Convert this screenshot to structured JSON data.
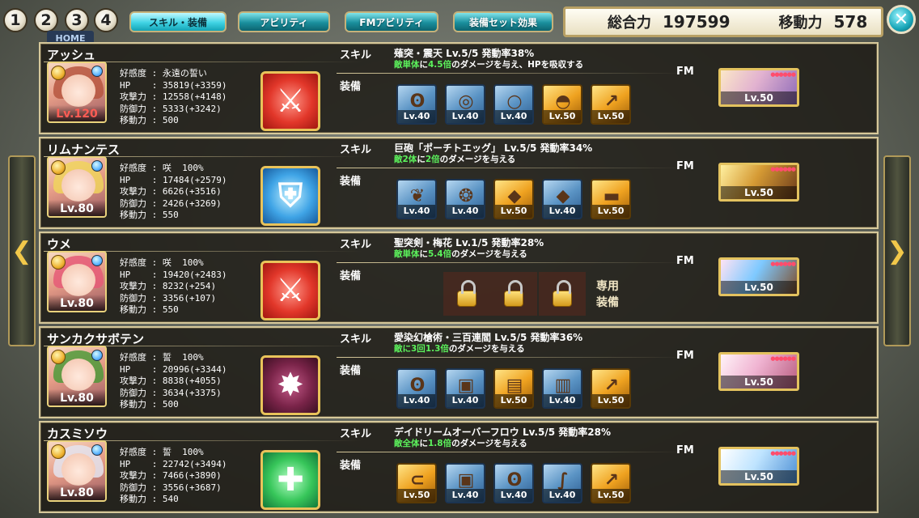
{
  "top": {
    "numbers": [
      "1",
      "2",
      "3",
      "4"
    ],
    "tabs": [
      "スキル・装備",
      "アビリティ",
      "FMアビリティ",
      "装備セット効果"
    ],
    "total_power_label": "総合力",
    "total_power_value": "197599",
    "movement_label": "移動力",
    "movement_value": "578",
    "close_icon": "close-icon",
    "home_label": "HOME"
  },
  "stat_labels": {
    "affinity": "好感度",
    "hp": "HP",
    "attack": "攻撃力",
    "defense": "防御力",
    "movement": "移動力"
  },
  "labels": {
    "skill": "スキル",
    "equip": "装備",
    "fm": "FM",
    "exclusive": "専用装備"
  },
  "characters": [
    {
      "name": "アッシュ",
      "level": "Lv.120",
      "affinity": "永遠の誓い",
      "hp": "35819(+3359)",
      "attack": "12558(+4148)",
      "defense": "5333(+3242)",
      "movement": "500",
      "skill_icon": "sword-icon",
      "skill_name": "薙突・震天 Lv.5/5 発動率38%",
      "skill_desc_a": "敵単体",
      "skill_desc_b": "に",
      "skill_desc_c": "4.5倍",
      "skill_desc_d": "のダメージを与え、HPを吸収する",
      "equips": [
        {
          "lv": "Lv.40",
          "tone": "blue",
          "icon": "necklace-icon"
        },
        {
          "lv": "Lv.40",
          "tone": "blue",
          "icon": "bracelet-icon"
        },
        {
          "lv": "Lv.40",
          "tone": "blue",
          "icon": "ring-icon"
        },
        {
          "lv": "Lv.50",
          "tone": "gold",
          "icon": "helmet-icon"
        },
        {
          "lv": "Lv.50",
          "tone": "gold",
          "icon": "spear-icon"
        }
      ],
      "fm_lv": "Lv.50"
    },
    {
      "name": "リムナンテス",
      "level": "Lv.80",
      "affinity": "咲  100%",
      "hp": "17484(+2579)",
      "attack": "6626(+3516)",
      "defense": "2426(+3269)",
      "movement": "550",
      "skill_icon": "shield-icon",
      "skill_name": "巨砲「ポーチトエッグ」 Lv.5/5 発動率34%",
      "skill_desc_a": "敵2体",
      "skill_desc_b": "に",
      "skill_desc_c": "2倍",
      "skill_desc_d": "のダメージを与える",
      "equips": [
        {
          "lv": "Lv.40",
          "tone": "blue",
          "icon": "earring-icon"
        },
        {
          "lv": "Lv.40",
          "tone": "blue",
          "icon": "amulet-icon"
        },
        {
          "lv": "Lv.50",
          "tone": "gold",
          "icon": "gem-icon"
        },
        {
          "lv": "Lv.40",
          "tone": "blue",
          "icon": "shield-icon"
        },
        {
          "lv": "Lv.50",
          "tone": "gold",
          "icon": "gun-icon"
        }
      ],
      "fm_lv": "Lv.50"
    },
    {
      "name": "ウメ",
      "level": "Lv.80",
      "affinity": "咲  100%",
      "hp": "19420(+2483)",
      "attack": "8232(+254)",
      "defense": "3356(+107)",
      "movement": "550",
      "skill_icon": "sword-icon",
      "skill_name": "聖突剣・梅花 Lv.1/5 発動率28%",
      "skill_desc_a": "敵単体",
      "skill_desc_b": "に",
      "skill_desc_c": "5.4倍",
      "skill_desc_d": "のダメージを与える",
      "equips": [],
      "fm_lv": "Lv.50"
    },
    {
      "name": "サンカクサボテン",
      "level": "Lv.80",
      "affinity": "誓  100%",
      "hp": "20996(+3344)",
      "attack": "8838(+4055)",
      "defense": "3634(+3375)",
      "movement": "500",
      "skill_icon": "dark-blade-icon",
      "skill_name": "愛染幻槍術・三百連閻 Lv.5/5 発動率36%",
      "skill_desc_a": "敵に",
      "skill_desc_b": "3回",
      "skill_desc_c": "1.3倍",
      "skill_desc_d": "のダメージを与える",
      "equips": [
        {
          "lv": "Lv.40",
          "tone": "blue",
          "icon": "necklace-icon"
        },
        {
          "lv": "Lv.40",
          "tone": "blue",
          "icon": "armor-icon"
        },
        {
          "lv": "Lv.50",
          "tone": "gold",
          "icon": "scroll-icon"
        },
        {
          "lv": "Lv.40",
          "tone": "blue",
          "icon": "book-icon"
        },
        {
          "lv": "Lv.50",
          "tone": "gold",
          "icon": "spear-icon"
        }
      ],
      "fm_lv": "Lv.50"
    },
    {
      "name": "カスミソウ",
      "level": "Lv.80",
      "affinity": "誓  100%",
      "hp": "22742(+3494)",
      "attack": "7466(+3890)",
      "defense": "3556(+3687)",
      "movement": "540",
      "skill_icon": "cross-icon",
      "skill_name": "デイドリームオーバーフロウ Lv.5/5 発動率28%",
      "skill_desc_a": "敵全体",
      "skill_desc_b": "に",
      "skill_desc_c": "1.8倍",
      "skill_desc_d": "のダメージを与える",
      "equips": [
        {
          "lv": "Lv.50",
          "tone": "gold",
          "icon": "belt-icon"
        },
        {
          "lv": "Lv.40",
          "tone": "blue",
          "icon": "armor-icon"
        },
        {
          "lv": "Lv.40",
          "tone": "blue",
          "icon": "necklace-icon"
        },
        {
          "lv": "Lv.40",
          "tone": "blue",
          "icon": "whip-icon"
        },
        {
          "lv": "Lv.50",
          "tone": "gold",
          "icon": "staff-icon"
        }
      ],
      "fm_lv": "Lv.50"
    }
  ]
}
